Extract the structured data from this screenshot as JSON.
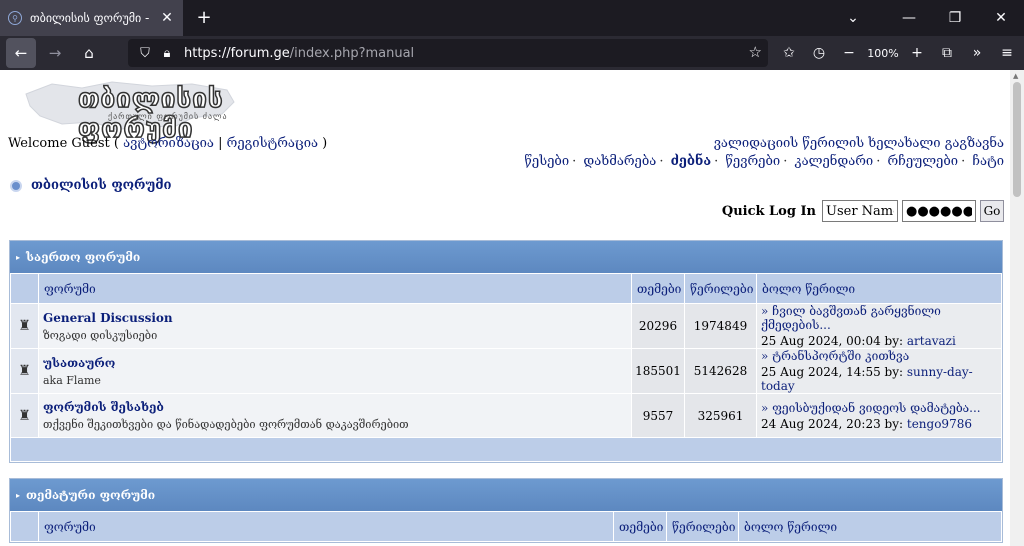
{
  "browser": {
    "tab_title": "თბილისის ფორუმი - Power",
    "url_domain": "https://forum.ge",
    "url_path": "/index.php?manual",
    "zoom": "100%"
  },
  "logo": {
    "title": "თბილისის ფორუმი",
    "subtitle": "ქართული ფორუმის ძალა"
  },
  "header": {
    "welcome_prefix": "Welcome Guest (",
    "login_link": "ავტორიზაცია",
    "sep": "|",
    "register_link": "რეგისტრაცია",
    "welcome_suffix": ")",
    "validation_link": "ვალიდაციის წერილის ხელახალი გაგზავნა"
  },
  "menu": [
    "წესები",
    "დახმარება",
    "ძებნა",
    "წევრები",
    "კალენდარი",
    "რჩეულები",
    "ჩატი"
  ],
  "breadcrumb": "თბილისის ფორუმი",
  "quick_login": {
    "label": "Quick Log In",
    "username_value": "User Name",
    "password_value": "●●●●●●●●",
    "go_label": "Go"
  },
  "columns": {
    "forum": "ფორუმი",
    "topics": "თემები",
    "posts": "წერილები",
    "last_post": "ბოლო წერილი"
  },
  "categories": [
    {
      "name": "საერთო ფორუმი",
      "forums": [
        {
          "name": "General Discussion",
          "desc": "ზოგადი დისკუსიები",
          "topics": "20296",
          "posts": "1974849",
          "last_title": "» ჩვილ ბავშვთან გარყვნილი ქმედების...",
          "last_date": "25 Aug 2024, 00:04 by:",
          "last_by": "artavazi"
        },
        {
          "name": "უსათაურო",
          "desc": "aka Flame",
          "topics": "185501",
          "posts": "5142628",
          "last_title": "» ტრანსპორტში კითხვა",
          "last_date": "25 Aug 2024, 14:55 by:",
          "last_by": "sunny-day-today"
        },
        {
          "name": "ფორუმის შესახებ",
          "desc": "თქვენი შეკითხვები და წინადადებები ფორუმთან დაკავშირებით",
          "topics": "9557",
          "posts": "325961",
          "last_title": "» ფეისბუქიდან ვიდეოს დამატება...",
          "last_date": "24 Aug 2024, 20:23 by:",
          "last_by": "tengo9786"
        }
      ]
    },
    {
      "name": "თემატური ფორუმი",
      "forums": []
    }
  ]
}
